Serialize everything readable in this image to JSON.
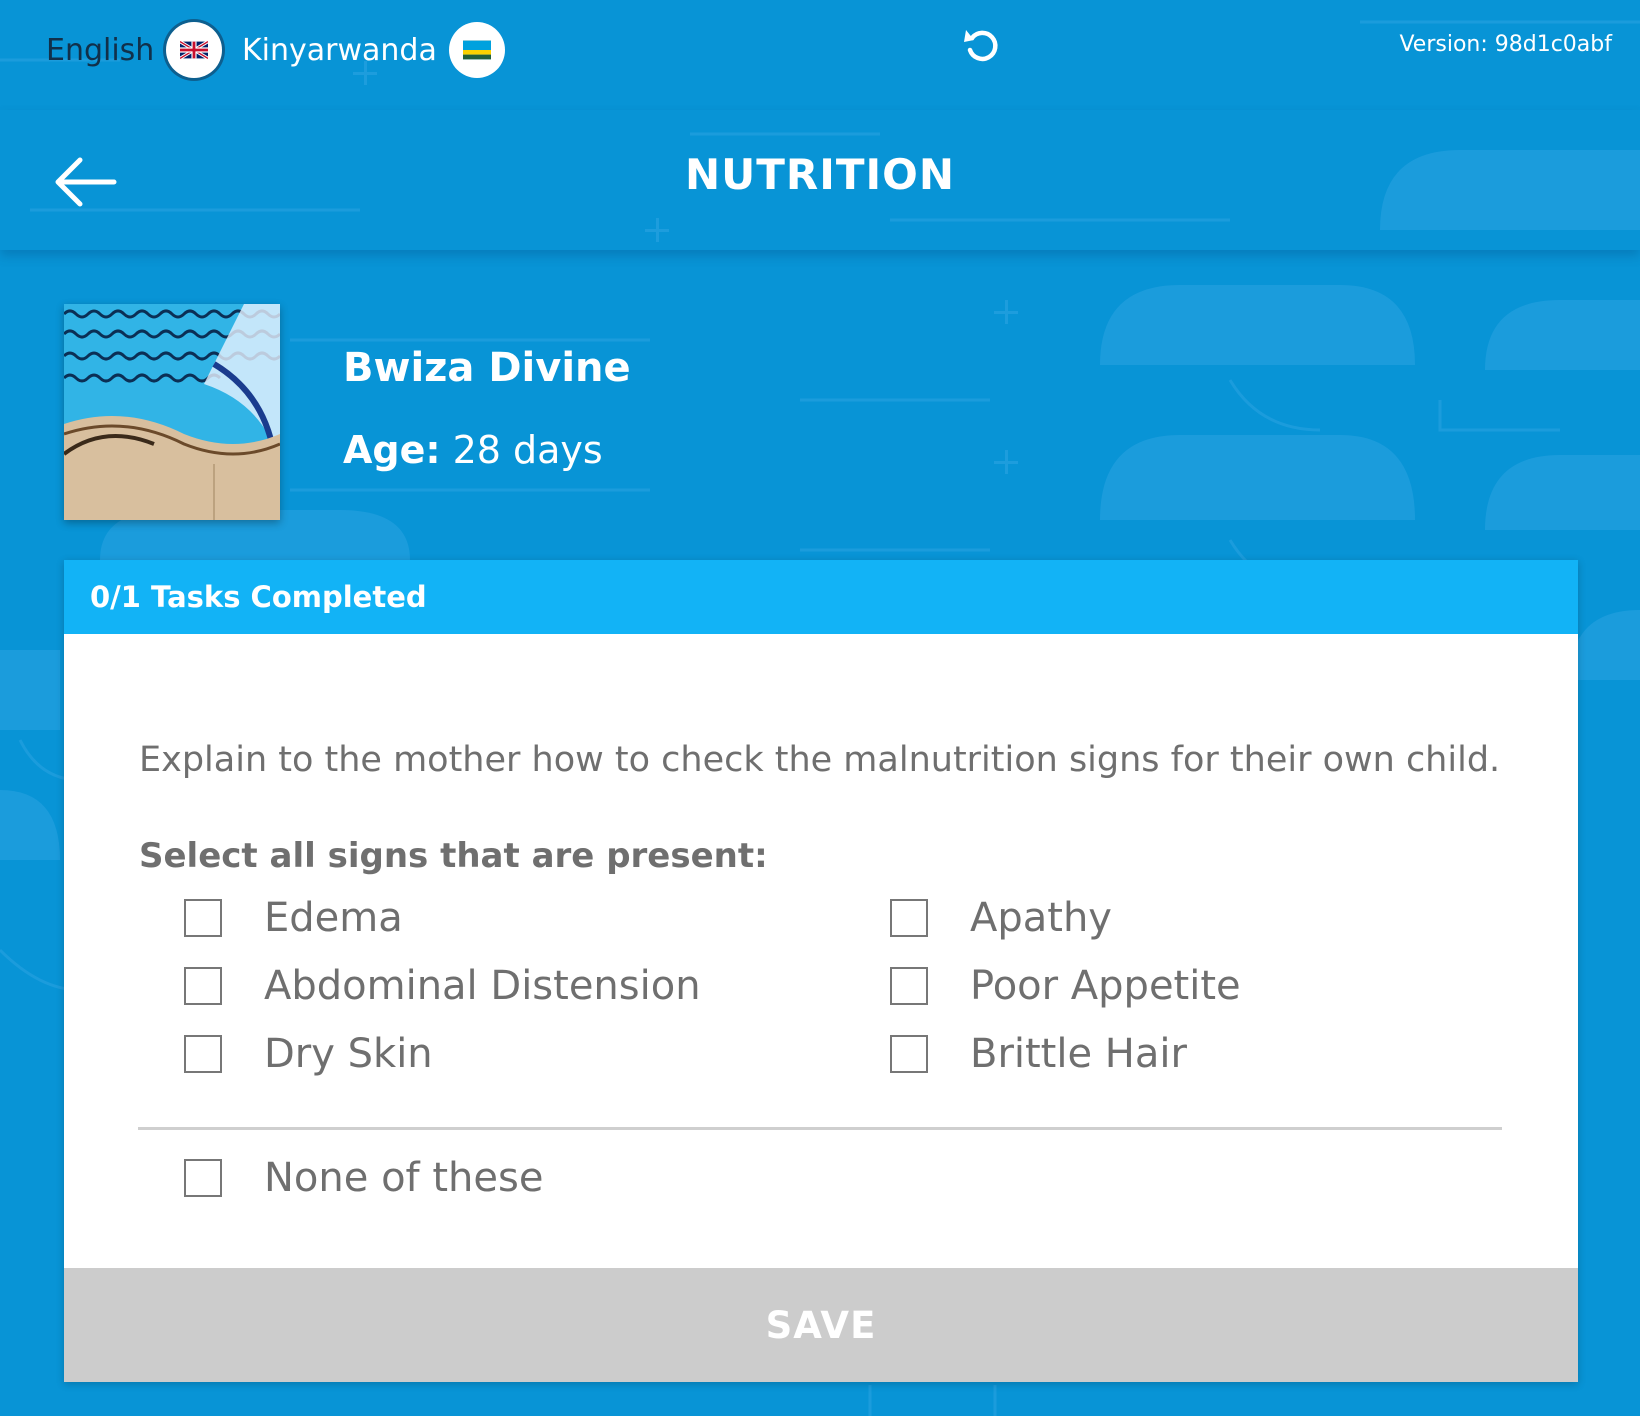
{
  "topbar": {
    "lang_english": "English",
    "lang_kinyarwanda": "Kinyarwanda",
    "version": "Version: 98d1c0abf"
  },
  "header": {
    "title": "NUTRITION"
  },
  "patient": {
    "name": "Bwiza Divine",
    "age_label": "Age:",
    "age_value": "28 days"
  },
  "card": {
    "tasks_status": "0/1 Tasks Completed",
    "instruction": "Explain to the mother how to check the malnutrition signs for their own child.",
    "question": "Select all signs that are present:",
    "options": [
      "Edema",
      "Apathy",
      "Abdominal Distension",
      "Poor Appetite",
      "Dry Skin",
      "Brittle Hair"
    ],
    "none_option": "None of these",
    "save_label": "SAVE"
  },
  "colors": {
    "background": "#0894d6",
    "card_header": "#12b3f6",
    "save_disabled": "#cccccc"
  },
  "icons": [
    "uk-flag-icon",
    "rwanda-flag-icon",
    "reload-icon",
    "back-arrow-icon"
  ]
}
